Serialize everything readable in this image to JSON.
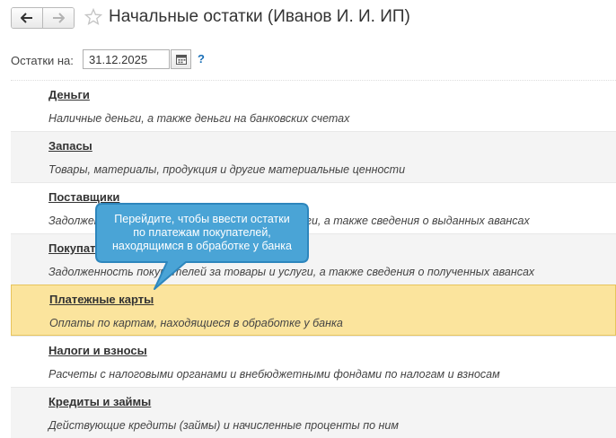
{
  "header": {
    "title": "Начальные остатки (Иванов И. И. ИП)",
    "back_icon": "arrow-left-icon",
    "forward_icon": "arrow-right-icon",
    "favorite_icon": "star-icon"
  },
  "date": {
    "label": "Остатки на:",
    "value": "31.12.2025",
    "help": "?"
  },
  "sections": [
    {
      "title": "Деньги",
      "description": "Наличные деньги, а также деньги на банковских счетах"
    },
    {
      "title": "Запасы",
      "description": "Товары, материалы, продукция и другие материальные ценности"
    },
    {
      "title": "Поставщики",
      "description": "Задолженность поставщикам за товары и услуги, а также сведения о выданных авансах"
    },
    {
      "title": "Покупатели",
      "description": "Задолженность покупателей за товары и услуги, а также сведения о полученных авансах"
    },
    {
      "title": "Платежные карты",
      "description": "Оплаты по картам, находящиеся в обработке у банка"
    },
    {
      "title": "Налоги и взносы",
      "description": "Расчеты с налоговыми органами и внебюджетными фондами по налогам и взносам"
    },
    {
      "title": "Кредиты и займы",
      "description": "Действующие кредиты (займы) и начисленные проценты по ним"
    }
  ],
  "tooltip": {
    "line1": "Перейдите, чтобы ввести остатки",
    "line2": "по платежам покупателей,",
    "line3": "находящимся в обработке у банка"
  },
  "colors": {
    "selected_row": "#fbe49d",
    "tooltip_fill": "#4aa4d6",
    "tooltip_border": "#2d86bd",
    "help": "#1a6fb7"
  }
}
